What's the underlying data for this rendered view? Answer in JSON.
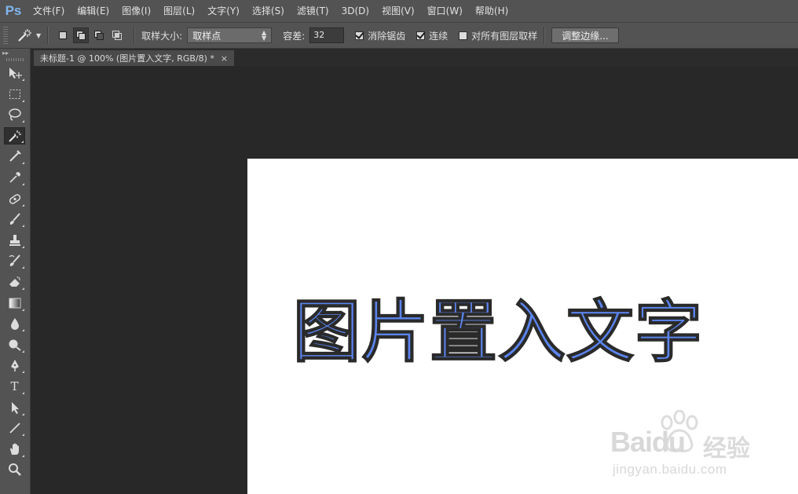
{
  "app": {
    "logo": "Ps"
  },
  "menu": [
    "文件(F)",
    "编辑(E)",
    "图像(I)",
    "图层(L)",
    "文字(Y)",
    "选择(S)",
    "滤镜(T)",
    "3D(D)",
    "视图(V)",
    "窗口(W)",
    "帮助(H)"
  ],
  "options": {
    "sample_size_label": "取样大小:",
    "sample_size_value": "取样点",
    "tolerance_label": "容差:",
    "tolerance_value": "32",
    "antialias_label": "消除锯齿",
    "contiguous_label": "连续",
    "sample_all_layers_label": "对所有图层取样",
    "refine_edge_label": "调整边缘..."
  },
  "document": {
    "tab_title": "未标题-1 @ 100% (图片置入文字, RGB/8) *",
    "close_glyph": "×",
    "canvas_text": "图片置入文字",
    "text_color": "#5b84ee"
  },
  "toolbar": {
    "tools": [
      "move-icon",
      "marquee-icon",
      "lasso-icon",
      "magic-wand-icon",
      "crop-icon",
      "eyedropper-icon",
      "healing-icon",
      "brush-icon",
      "stamp-icon",
      "history-brush-icon",
      "eraser-icon",
      "gradient-icon",
      "blur-icon",
      "dodge-icon",
      "pen-icon",
      "type-icon",
      "path-select-icon",
      "line-icon",
      "hand-icon",
      "zoom-icon"
    ],
    "type_glyph": "T"
  },
  "watermark": {
    "brand": "Baidu",
    "brand_cn": "经验",
    "url": "jingyan.baidu.com"
  }
}
